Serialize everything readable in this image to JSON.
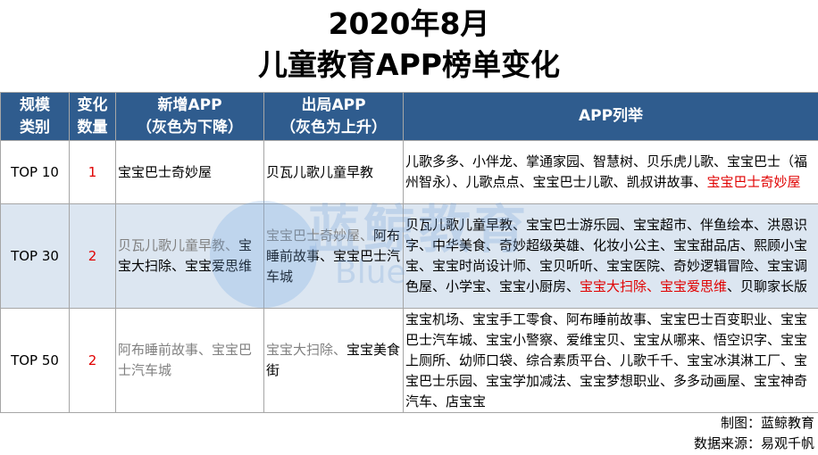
{
  "title": {
    "line1": "2020年8月",
    "line2": "儿童教育APP榜单变化"
  },
  "headers": {
    "category": [
      "规模",
      "类别"
    ],
    "count": [
      "变化",
      "数量"
    ],
    "new_app": [
      "新增APP",
      "（灰色为下降）"
    ],
    "out_app": [
      "出局APP",
      "（灰色为上升）"
    ],
    "list": "APP列举"
  },
  "rows": [
    {
      "category": "TOP 10",
      "count": "1",
      "new": {
        "grey": "",
        "normal": "宝宝巴士奇妙屋"
      },
      "out": {
        "grey": "",
        "normal": "贝瓦儿歌儿童早教"
      },
      "list": {
        "normal": "儿歌多多、小伴龙、掌通家园、智慧树、贝乐虎儿歌、宝宝巴士（福州智永）、儿歌点点、宝宝巴士儿歌、凯叔讲故事、",
        "red": "宝宝巴士奇妙屋",
        "tail": ""
      }
    },
    {
      "category": "TOP 30",
      "count": "2",
      "new": {
        "grey": "贝瓦儿歌儿童早教、",
        "normal": "宝宝大扫除、宝宝爱思维"
      },
      "out": {
        "grey": "宝宝巴士奇妙屋、",
        "normal": "阿布睡前故事、宝宝巴士汽车城"
      },
      "list": {
        "normal": "贝瓦儿歌儿童早教、宝宝巴士游乐园、宝宝超市、伴鱼绘本、洪恩识字、中华美食、奇妙超级英雄、化妆小公主、宝宝甜品店、熙顾小宝宝、宝宝时尚设计师、宝贝听听、宝宝医院、奇妙逻辑冒险、宝宝调色屋、小学宝、宝宝小厨房、",
        "red": "宝宝大扫除、宝宝爱思维",
        "tail": "、贝聊家长版"
      }
    },
    {
      "category": "TOP 50",
      "count": "2",
      "new": {
        "grey": "阿布睡前故事、宝宝巴士汽车城",
        "normal": ""
      },
      "out": {
        "grey": "宝宝大扫除、",
        "normal": "宝宝美食街"
      },
      "list": {
        "normal": "宝宝机场、宝宝手工零食、阿布睡前故事、宝宝巴士百变职业、宝宝巴士汽车城、宝宝小警察、爱维宝贝、宝宝从哪来、悟空识字、宝宝上厕所、幼师口袋、综合素质平台、儿歌千千、宝宝冰淇淋工厂、宝宝巴士乐园、宝宝学加减法、宝宝梦想职业、多多动画屋、宝宝神奇汽车、店宝宝",
        "red": "",
        "tail": ""
      }
    }
  ],
  "footer": {
    "made_by": "制图：蓝鲸教育",
    "source": "数据来源：易观千帆"
  },
  "watermark": {
    "text": "蓝鲸教育",
    "sub": "Blue"
  },
  "colors": {
    "header_bg": "#2F5C8E",
    "row_alt_bg": "#DCE6F1",
    "highlight": "#E00000",
    "grey_text": "#808080"
  }
}
